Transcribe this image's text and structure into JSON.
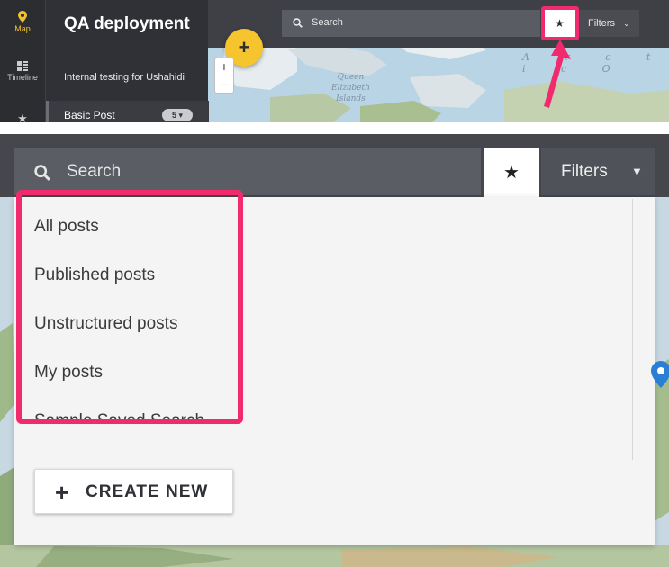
{
  "top": {
    "rail": {
      "map_label": "Map",
      "timeline_label": "Timeline"
    },
    "deployment": {
      "title": "QA deployment",
      "subtitle": "Internal testing for Ushahidi",
      "survey": {
        "label": "Basic Post",
        "count": "5"
      }
    },
    "search_placeholder": "Search",
    "star_glyph": "★",
    "filters_label": "Filters",
    "fab_glyph": "+",
    "zoom_in": "+",
    "zoom_out": "−",
    "map_labels": {
      "queen_1": "Queen",
      "queen_2": "Elizabeth",
      "queen_3": "Islands",
      "arctic": "A r c t i c   O"
    }
  },
  "bottom": {
    "search_placeholder": "Search",
    "star_glyph": "★",
    "filters_label": "Filters",
    "options": [
      "All posts",
      "Published posts",
      "Unstructured posts",
      "My posts",
      "Sample Saved Search"
    ],
    "create_plus": "+",
    "create_label": "CREATE NEW"
  },
  "colors": {
    "highlight": "#f02a6d",
    "accent_yellow": "#f6c42c",
    "dark_bar": "#45474c",
    "panel": "#f4f4f4"
  }
}
